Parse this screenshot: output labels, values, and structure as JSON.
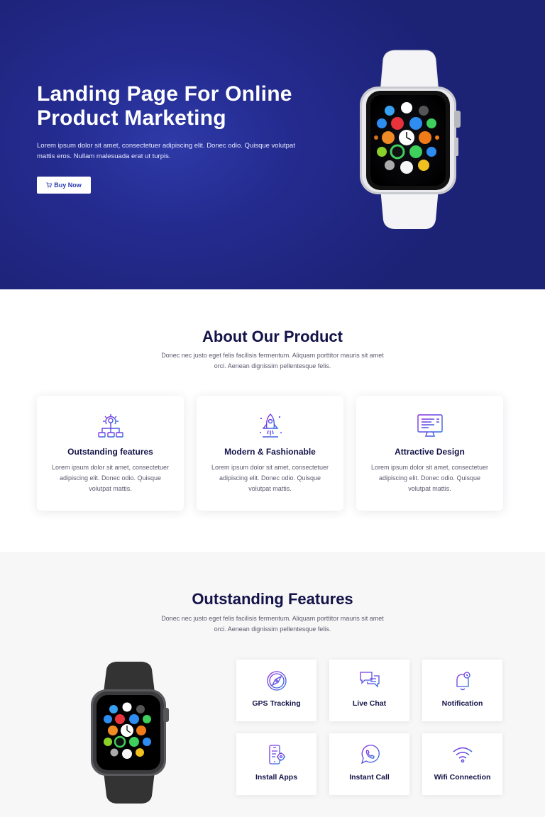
{
  "hero": {
    "title": "Landing Page For Online Product Marketing",
    "text": "Lorem ipsum dolor sit amet, consectetuer adipiscing elit. Donec odio. Quisque volutpat mattis eros. Nullam malesuada erat ut turpis.",
    "button_label": "Buy Now"
  },
  "about": {
    "title": "About Our Product",
    "subtitle": "Donec nec justo eget felis facilisis fermentum. Aliquam porttitor mauris sit amet orci. Aenean dignissim pellentesque felis.",
    "cards": [
      {
        "title": "Outstanding features",
        "text": "Lorem ipsum dolor sit amet, consectetuer adipiscing elit. Donec odio. Quisque volutpat mattis.",
        "icon": "gear-network-icon"
      },
      {
        "title": "Modern & Fashionable",
        "text": "Lorem ipsum dolor sit amet, consectetuer adipiscing elit. Donec odio. Quisque volutpat mattis.",
        "icon": "rocket-icon"
      },
      {
        "title": "Attractive Design",
        "text": "Lorem ipsum dolor sit amet, consectetuer adipiscing elit. Donec odio. Quisque volutpat mattis.",
        "icon": "monitor-icon"
      }
    ]
  },
  "features": {
    "title": "Outstanding Features",
    "subtitle": "Donec nec justo eget felis facilisis fermentum. Aliquam porttitor mauris sit amet orci. Aenean dignissim pellentesque felis.",
    "items": [
      {
        "label": "GPS Tracking",
        "icon": "compass-icon"
      },
      {
        "label": "Live Chat",
        "icon": "chat-icon"
      },
      {
        "label": "Notification",
        "icon": "bell-icon"
      },
      {
        "label": "Install Apps",
        "icon": "phone-settings-icon"
      },
      {
        "label": "Instant Call",
        "icon": "whatsapp-icon"
      },
      {
        "label": "Wifi Connection",
        "icon": "wifi-icon"
      }
    ]
  },
  "colors": {
    "hero_bg": "#242b8f",
    "heading": "#141349",
    "icon_gradient_start": "#6a3df0",
    "icon_gradient_end": "#2d7fe0"
  }
}
